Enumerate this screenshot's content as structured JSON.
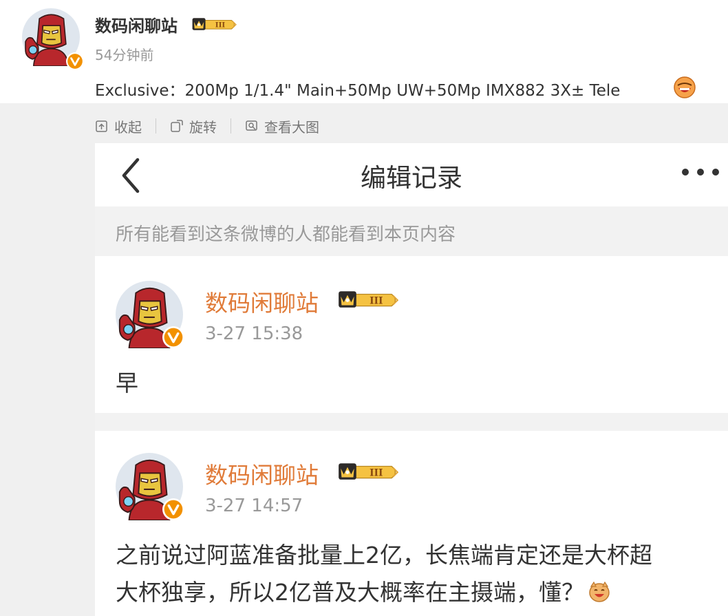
{
  "post": {
    "author": "数码闲聊站",
    "time": "54分钟前",
    "text": "Exclusive：200Mp 1/1.4\" Main+50Mp UW+50Mp IMX882 3X± Tele"
  },
  "toolbar": {
    "collapse_label": "收起",
    "rotate_label": "旋转",
    "view_large_label": "查看大图"
  },
  "screenshot": {
    "title": "编辑记录",
    "notice": "所有能看到这条微博的人都能看到本页内容",
    "entries": [
      {
        "author": "数码闲聊站",
        "time": "3-27 15:38",
        "text": "早"
      },
      {
        "author": "数码闲聊站",
        "time": "3-27 14:57",
        "text_line1": "之前说过阿蓝准备批量上2亿，长焦端肯定还是大杯超",
        "text_line2": "大杯独享，所以2亿普及大概率在主摄端，懂？"
      }
    ]
  },
  "colors": {
    "author_orange": "#e07b39",
    "muted": "#999999",
    "badge_gold": "#f5c242",
    "verified_badge": "#f29100"
  },
  "icons": [
    "avatar-ironman",
    "verified-badge-icon",
    "crown-level-badge-icon",
    "collapse-icon",
    "rotate-icon",
    "zoom-image-icon",
    "back-chevron-icon",
    "more-dots-icon",
    "grin-emoji-icon",
    "doge-emoji-icon"
  ]
}
